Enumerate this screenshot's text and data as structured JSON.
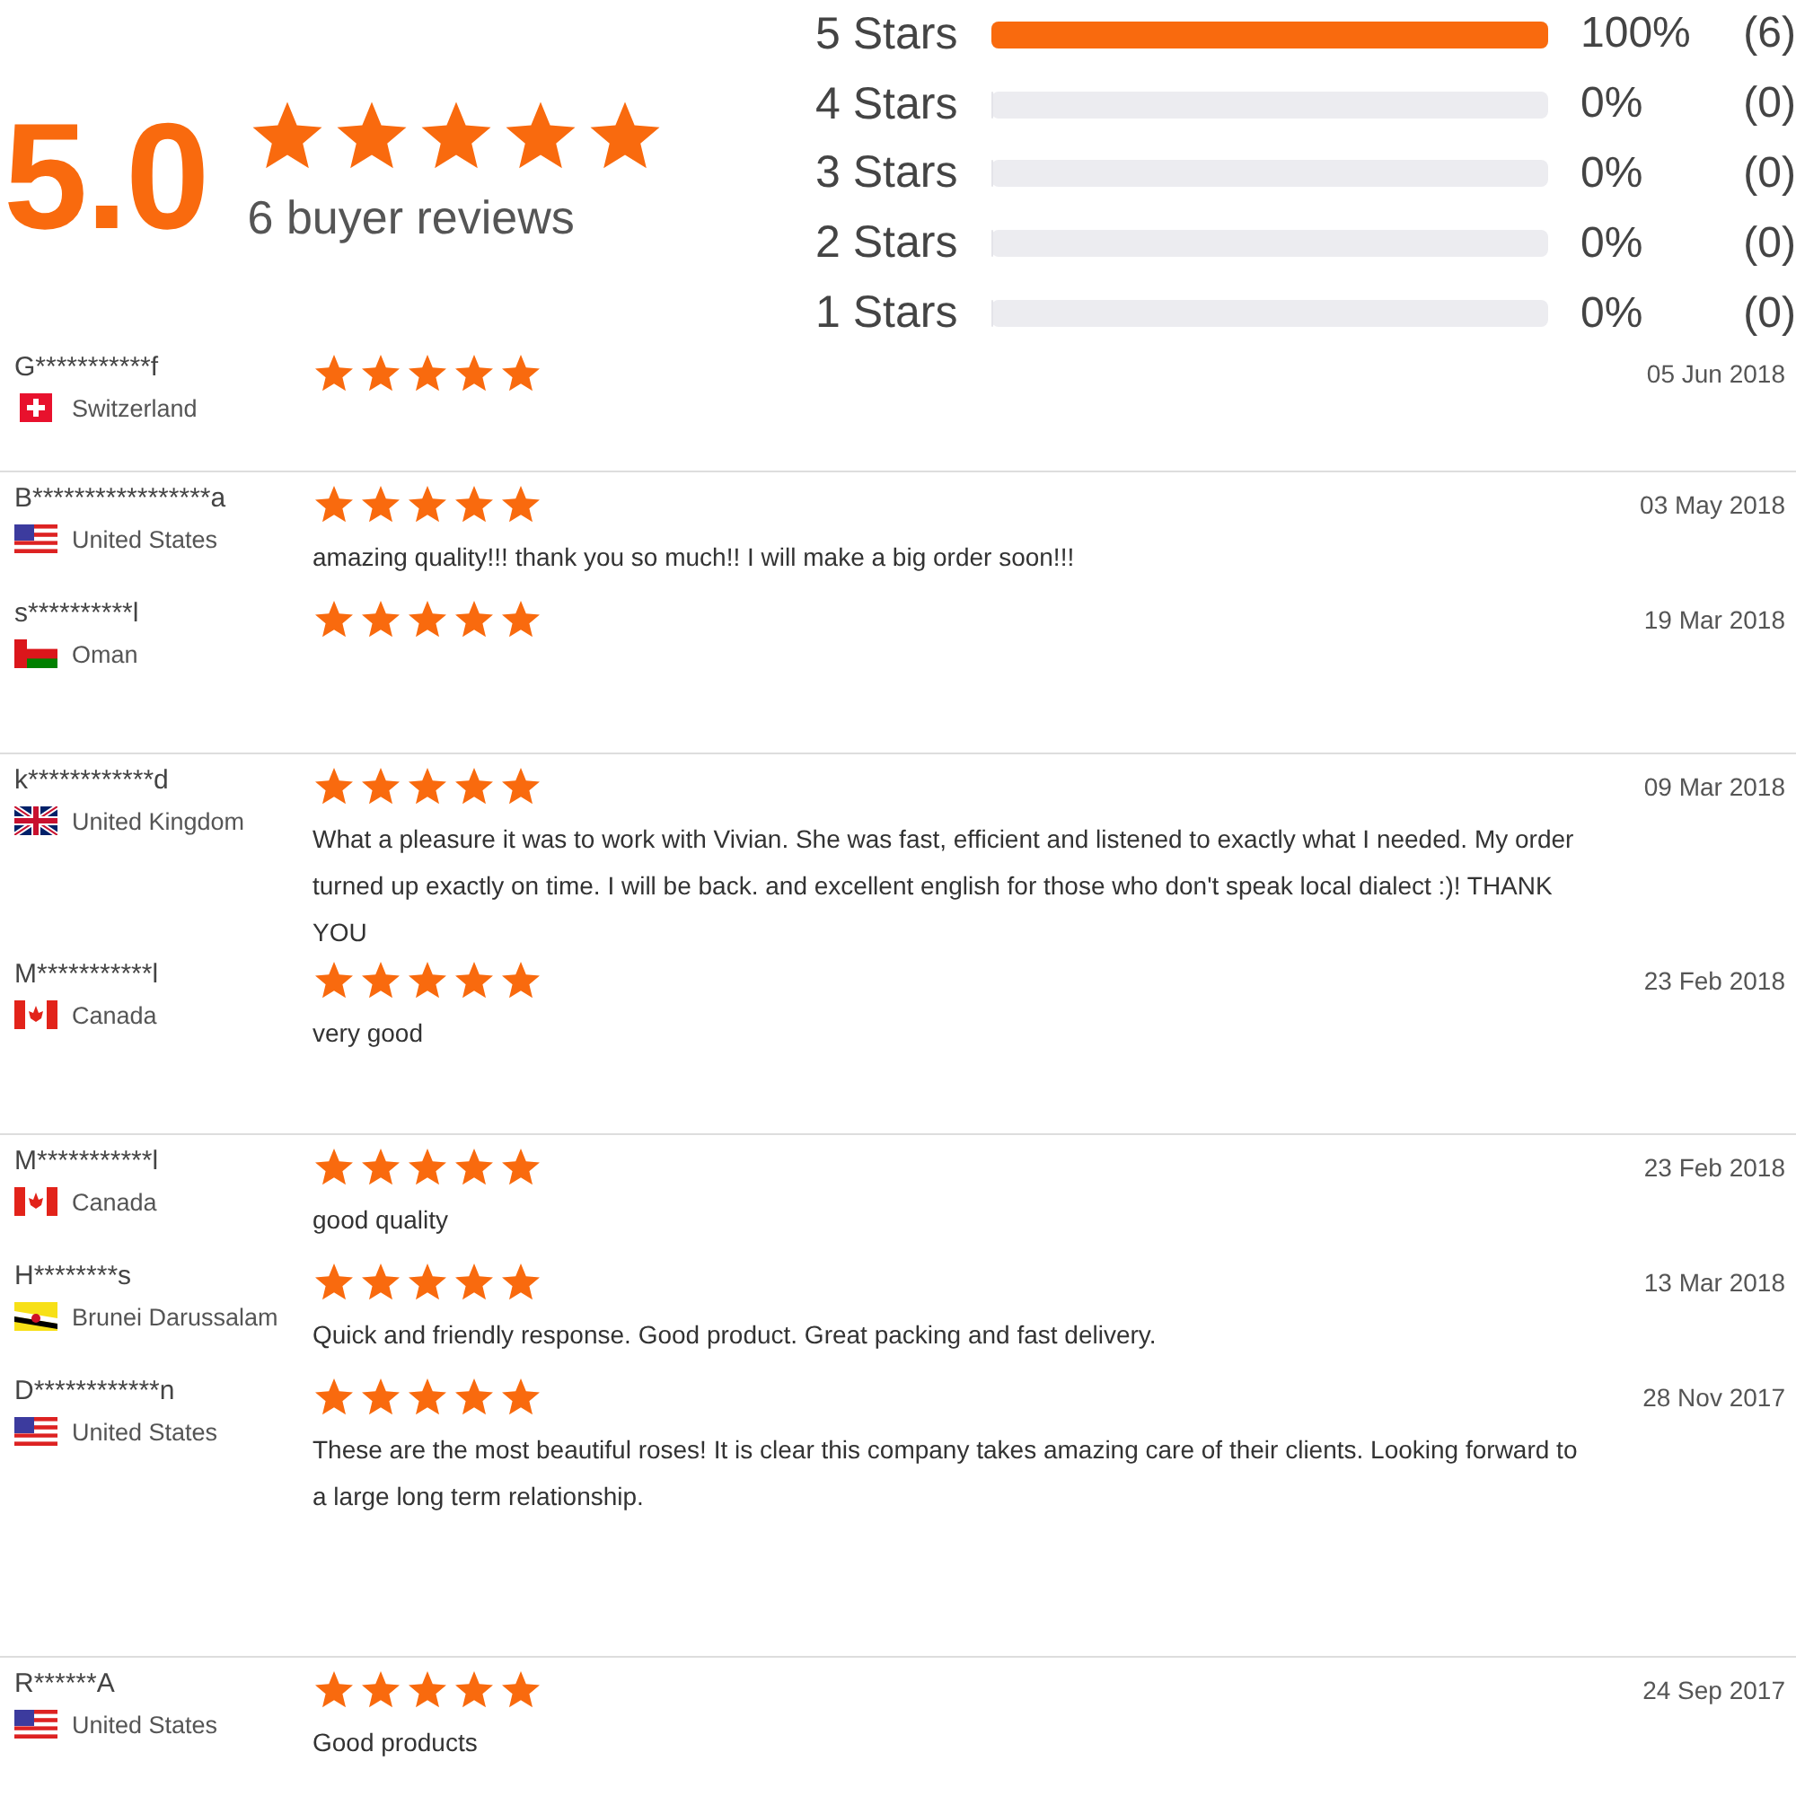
{
  "summary": {
    "score": "5.0",
    "stars": 5,
    "count_text": "6 buyer reviews"
  },
  "distribution": [
    {
      "label": "5 Stars",
      "level": 1,
      "percent": "100%",
      "count": "(6)"
    },
    {
      "label": "4 Stars",
      "level": 0,
      "percent": "0%",
      "count": "(0)"
    },
    {
      "label": "3 Stars",
      "level": 0,
      "percent": "0%",
      "count": "(0)"
    },
    {
      "label": "2 Stars",
      "level": 0,
      "percent": "0%",
      "count": "(0)"
    },
    {
      "label": "1 Stars",
      "level": 0,
      "percent": "0%",
      "count": "(0)"
    }
  ],
  "groups": [
    {
      "reviews": [
        {
          "name": "G***********f",
          "country": "Switzerland",
          "flag": {
            "kind": "ch"
          },
          "stars": 5,
          "date": "05 Jun 2018"
        }
      ]
    },
    {
      "reviews": [
        {
          "name": "B*****************a",
          "country": "United States",
          "flag": {
            "kind": "us"
          },
          "stars": 5,
          "date": "03 May 2018",
          "text": "amazing quality!!! thank you so much!! I will make a big order soon!!!"
        },
        {
          "name": "s**********l",
          "country": "Oman",
          "flag": {
            "kind": "om"
          },
          "stars": 5,
          "date": "19 Mar 2018"
        }
      ]
    },
    {
      "reviews": [
        {
          "name": "k************d",
          "country": "United Kingdom",
          "flag": {
            "kind": "gb"
          },
          "stars": 5,
          "date": "09 Mar 2018",
          "text": "What a pleasure it was to work with Vivian. She was fast, efficient and listened to exactly what I needed. My order turned up exactly on time. I will be back. and excellent english for those who don't speak local dialect :)! THANK YOU"
        },
        {
          "name": "M***********l",
          "country": "Canada",
          "flag": {
            "kind": "ca"
          },
          "stars": 5,
          "date": "23 Feb 2018",
          "text": "very good"
        }
      ]
    },
    {
      "reviews": [
        {
          "name": "M***********l",
          "country": "Canada",
          "flag": {
            "kind": "ca"
          },
          "stars": 5,
          "date": "23 Feb 2018",
          "text": "good quality"
        },
        {
          "name": "H********s",
          "country": "Brunei Darussalam",
          "flag": {
            "kind": "bn"
          },
          "stars": 5,
          "date": "13 Mar 2018",
          "text": "Quick and friendly response. Good product. Great packing and fast delivery."
        },
        {
          "name": "D************n",
          "country": "United States",
          "flag": {
            "kind": "us"
          },
          "stars": 5,
          "date": "28 Nov 2017",
          "text": "These are the most beautiful roses! It is clear this company takes amazing care of their clients. Looking forward to a large long term relationship."
        }
      ]
    },
    {
      "reviews": [
        {
          "name": "R******A",
          "country": "United States",
          "flag": {
            "kind": "us"
          },
          "stars": 5,
          "date": "24 Sep 2017",
          "text": "Good products"
        }
      ]
    }
  ]
}
